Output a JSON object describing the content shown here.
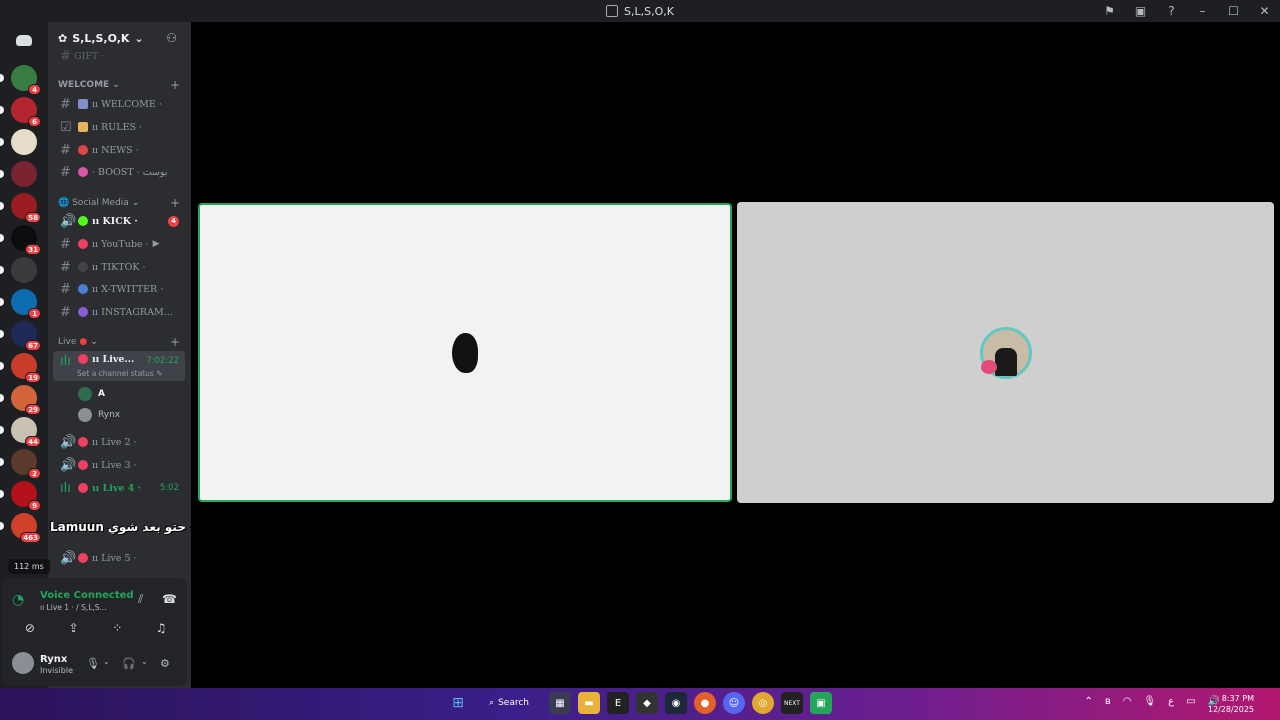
{
  "window": {
    "title": "S,L,S,O,K"
  },
  "server": {
    "name": "S,L,S,O,K"
  },
  "guilds": [
    {
      "badge": "4",
      "color": "#3a7d44"
    },
    {
      "badge": "6",
      "color": "#b3262f"
    },
    {
      "badge": "",
      "color": "#e6ddc8"
    },
    {
      "badge": "",
      "color": "#7a2431"
    },
    {
      "badge": "58",
      "color": "#9b1c23"
    },
    {
      "badge": "31",
      "color": "#0d0d0d"
    },
    {
      "badge": "",
      "color": "#3a3a3a"
    },
    {
      "badge": "1",
      "color": "#0d6bb0"
    },
    {
      "badge": "67",
      "color": "#1d2a55"
    },
    {
      "badge": "19",
      "color": "#c93c2a"
    },
    {
      "badge": "29",
      "color": "#d2643a"
    },
    {
      "badge": "44",
      "color": "#c9c2b3"
    },
    {
      "badge": "2",
      "color": "#5a3a2a"
    },
    {
      "badge": "9",
      "color": "#b3121a"
    },
    {
      "badge": "463",
      "color": "#d2402a"
    }
  ],
  "sidebar": {
    "faded_channel": "GIFT ·",
    "cat_welcome": "WELCOME",
    "ch_welcome": "ıı WELCOME ·",
    "ch_rules": "ıı RULES ·",
    "ch_news": "ıı NEWS ·",
    "ch_boost": "· BOOST · بوست",
    "cat_social": "Social Media",
    "ch_kick": "ıı KICK ·",
    "ch_kick_badge": "4",
    "ch_youtube": "ıı YouTube ·",
    "ch_tiktok": "ıı TIKTOK ·",
    "ch_twitter": "ıı X-TWITTER ·",
    "ch_instagram": "ıı INSTAGRAM...",
    "cat_live": "Live",
    "ch_live1": "ıı Live...",
    "ch_live1_time": "7:02:22",
    "channel_status": "Set a channel status",
    "voice_user_a": "A",
    "voice_user_rynx": "Rynx",
    "ch_live2": "ıı Live 2 ·",
    "ch_live3": "ıı Live 3 ·",
    "ch_live4": "ıı Live 4 ·",
    "ch_live4_time": "5:02",
    "ch_live5": "ıı Live 5 ·"
  },
  "overlay": {
    "name": "Lamuun",
    "message": "اخر مره بجرب ايث حتو بعد شوي"
  },
  "ping": "112 ms",
  "voice": {
    "title": "Voice Connected",
    "sub": "ıı Live 1 · / S,L,S..."
  },
  "user": {
    "name": "Rynx",
    "status": "Invisible"
  },
  "taskbar": {
    "search": "Search",
    "time": "8:37 PM",
    "date": "12/28/2025"
  },
  "colors": {
    "speaking": "#23a55a",
    "accent": "#5865f2",
    "badge": "#f23f43"
  }
}
